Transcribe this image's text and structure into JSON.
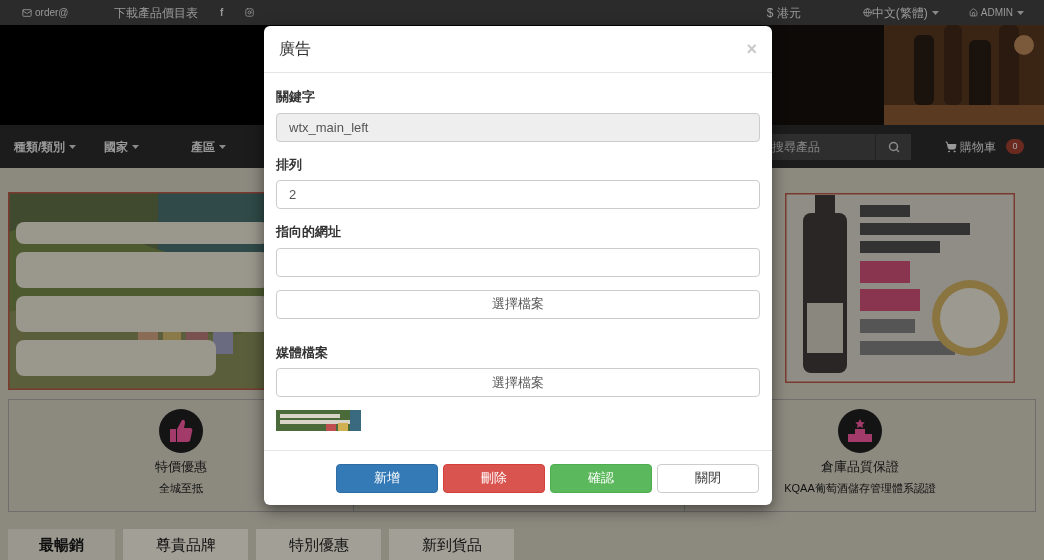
{
  "top_bar": {
    "email": "order@",
    "price_list": "下載產品價目表",
    "facebook": "f",
    "currency": "$ 港元",
    "language": "中文(繁體)",
    "user": "ADMIN"
  },
  "nav": {
    "items": [
      {
        "label": "種類/類別"
      },
      {
        "label": "國家"
      },
      {
        "label": "產區"
      }
    ],
    "search_placeholder": "搜尋產品",
    "cart": "購物車",
    "cart_count": "0"
  },
  "features": [
    {
      "kind": "thumbs-up",
      "title": "特價優惠",
      "subtitle": "全城至抵"
    },
    {
      "kind": "podium",
      "title": "倉庫品質保證",
      "subtitle": "KQAA葡萄酒儲存管理體系認證"
    }
  ],
  "tabs": [
    {
      "label": "最暢銷",
      "selected": true
    },
    {
      "label": "尊貴品牌",
      "selected": false
    },
    {
      "label": "特別優惠",
      "selected": false
    },
    {
      "label": "新到貨品",
      "selected": false
    }
  ],
  "modal": {
    "title": "廣告",
    "close": "×",
    "fields": [
      {
        "kind": "input",
        "label": "關鍵字",
        "value": "wtx_main_left",
        "disabled": true
      },
      {
        "kind": "input",
        "label": "排列",
        "value": "2",
        "disabled": false
      },
      {
        "kind": "input",
        "label": "指向的網址",
        "disabled": false
      },
      {
        "kind": "file",
        "button": "選擇檔案"
      },
      {
        "kind": "file",
        "label": "媒體檔案",
        "button": "選擇檔案",
        "thumbnail": true
      }
    ],
    "buttons": [
      {
        "label": "新增",
        "kind": "primary"
      },
      {
        "label": "刪除",
        "kind": "danger"
      },
      {
        "label": "確認",
        "kind": "success"
      },
      {
        "label": "關閉",
        "kind": "default"
      }
    ]
  }
}
